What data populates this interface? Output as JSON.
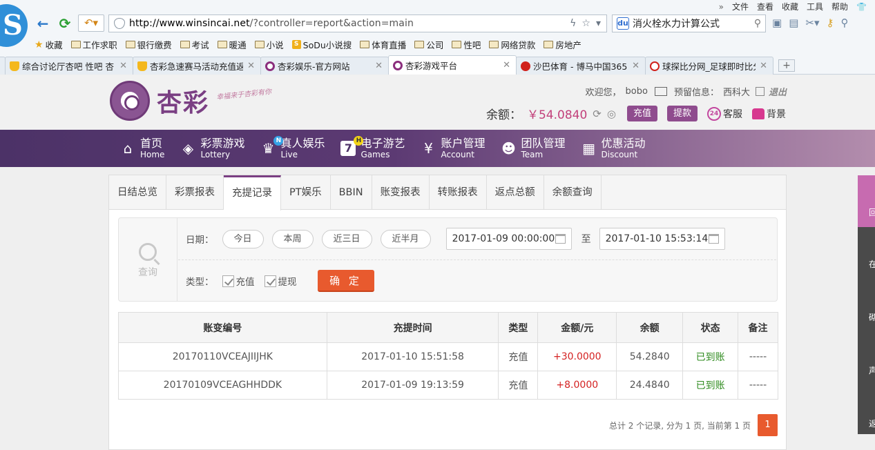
{
  "browser": {
    "menu": [
      "»",
      "文件",
      "查看",
      "收藏",
      "工具",
      "帮助"
    ],
    "url_host": "http://www.winsincai.net",
    "url_rest": "/?controller=report&action=main",
    "search_text": "消火栓水力计算公式",
    "bookmarks": [
      "收藏",
      "工作求职",
      "银行缴费",
      "考试",
      "暖通",
      "小说",
      "SoDu小说搜",
      "体育直播",
      "公司",
      "性吧",
      "网络贷款",
      "房地产"
    ],
    "tabs": [
      {
        "title": "综合讨论厅杏吧 性吧 杏",
        "active": false
      },
      {
        "title": "杏彩急速赛马活动充值返",
        "active": false
      },
      {
        "title": "杏彩娱乐-官方网站",
        "active": false
      },
      {
        "title": "杏彩游戏平台",
        "active": true
      },
      {
        "title": "沙巴体育 - 博马中国365",
        "active": false
      },
      {
        "title": "球探比分网_足球即时比分",
        "active": false
      }
    ]
  },
  "site": {
    "logo_text": "杏彩",
    "slogan": "幸福来于杏彩有你",
    "welcome": "欢迎您，",
    "username": "bobo",
    "reserved_label": "预留信息：",
    "reserved_value": "西科大",
    "logout": "退出",
    "balance_label": "余额：",
    "balance_value": "￥54.0840",
    "recharge": "充值",
    "withdraw": "提款",
    "service": "客服",
    "background": "背景"
  },
  "nav": [
    {
      "cn": "首页",
      "en": "Home",
      "icon": "home-icon"
    },
    {
      "cn": "彩票游戏",
      "en": "Lottery",
      "icon": "lottery-icon"
    },
    {
      "cn": "真人娱乐",
      "en": "Live",
      "icon": "live-icon",
      "badge": "N"
    },
    {
      "cn": "电子游艺",
      "en": "Games",
      "icon": "games-icon",
      "badge": "H"
    },
    {
      "cn": "账户管理",
      "en": "Account",
      "icon": "account-icon"
    },
    {
      "cn": "团队管理",
      "en": "Team",
      "icon": "team-icon"
    },
    {
      "cn": "优惠活动",
      "en": "Discount",
      "icon": "gift-icon"
    }
  ],
  "subtabs": [
    "日结总览",
    "彩票报表",
    "充提记录",
    "PT娱乐",
    "BBIN",
    "账变报表",
    "转账报表",
    "返点总额",
    "余额查询"
  ],
  "query": {
    "side_label": "查询",
    "date_label": "日期：",
    "quick_dates": [
      "今日",
      "本周",
      "近三日",
      "近半月"
    ],
    "start": "2017-01-09 00:00:00",
    "to": "至",
    "end": "2017-01-10 15:53:14",
    "type_label": "类型：",
    "types": [
      "充值",
      "提现"
    ],
    "confirm": "确 定"
  },
  "table": {
    "headers": [
      "账变编号",
      "充提时间",
      "类型",
      "金额/元",
      "余额",
      "状态",
      "备注"
    ],
    "rows": [
      [
        "20170110VCEAJIIJHK",
        "2017-01-10 15:51:58",
        "充值",
        "+30.0000",
        "54.2840",
        "已到账",
        "-----"
      ],
      [
        "20170109VCEAGHHDDK",
        "2017-01-09 19:13:59",
        "充值",
        "+8.0000",
        "24.4840",
        "已到账",
        "-----"
      ]
    ]
  },
  "pager": {
    "summary": "总计 2 个记录, 分为 1 页, 当前第 1 页",
    "current": "1"
  },
  "float_bar": [
    "回",
    "在",
    "砌",
    "声",
    "返"
  ],
  "colors": {
    "accent": "#7a3f83",
    "orange": "#e85a2e",
    "amount": "#d42121",
    "status_ok": "#2e8b1e"
  }
}
